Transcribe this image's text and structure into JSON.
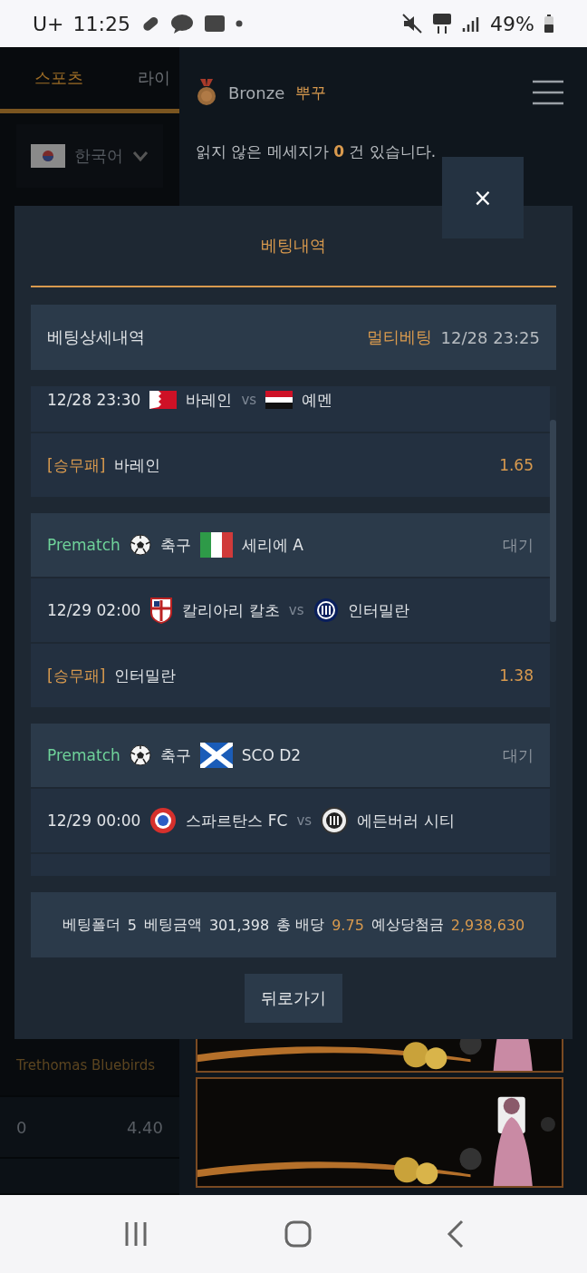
{
  "status_bar": {
    "carrier": "U+",
    "time": "11:25",
    "battery": "49%"
  },
  "background": {
    "tabs": [
      {
        "label": "스포츠",
        "selected": true
      },
      {
        "label": "라이",
        "selected": false
      }
    ],
    "language": "한국어",
    "rows": [
      {
        "label": "Trethomas Bluebirds"
      },
      {
        "label": "0",
        "value": "4.40"
      }
    ]
  },
  "side_panel": {
    "rank": "Bronze",
    "username": "뿌꾸",
    "message": "읽지 않은 메세지가 **0** 건 있습니다."
  },
  "modal": {
    "close": "×",
    "title": "베팅내역",
    "header": {
      "label": "베팅상세내역",
      "type": "멀티베팅",
      "time": "12/28 23:25"
    },
    "bets": [
      {
        "match": {
          "time": "12/28 23:30",
          "home": "바레인",
          "vs": "vs",
          "away": "예멘"
        },
        "pick": {
          "market": "[승무패]",
          "selection": "바레인",
          "odds": "1.65"
        }
      },
      {
        "header": {
          "mode": "Prematch",
          "sport": "축구",
          "league": "세리에 A",
          "status": "대기"
        },
        "match": {
          "time": "12/29 02:00",
          "home": "칼리아리 칼초",
          "vs": "vs",
          "away": "인터밀란"
        },
        "pick": {
          "market": "[승무패]",
          "selection": "인터밀란",
          "odds": "1.38"
        }
      },
      {
        "header": {
          "mode": "Prematch",
          "sport": "축구",
          "league": "SCO D2",
          "status": "대기"
        },
        "match": {
          "time": "12/29 00:00",
          "home": "스파르탄스 FC",
          "vs": "vs",
          "away": "에든버러 시티"
        }
      }
    ],
    "summary": [
      {
        "label": "베팅폴더",
        "value": "5",
        "highlight": false
      },
      {
        "label": "베팅금액",
        "value": "301,398",
        "highlight": false
      },
      {
        "label": "총 배당",
        "value": "9.75",
        "highlight": true
      },
      {
        "label": "예상당첨금",
        "value": "2,938,630",
        "highlight": true
      }
    ],
    "back_button": "뒤로가기"
  }
}
